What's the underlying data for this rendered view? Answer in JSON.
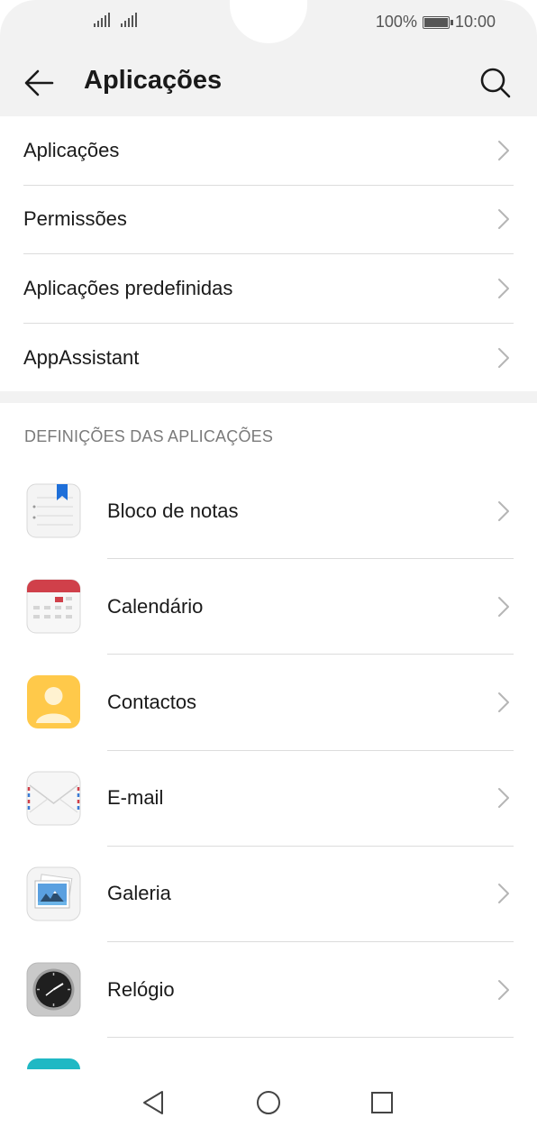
{
  "status_bar": {
    "battery_percent": "100%",
    "time": "10:00"
  },
  "title_bar": {
    "title": "Aplicações"
  },
  "menu": {
    "items": [
      {
        "label": "Aplicações"
      },
      {
        "label": "Permissões"
      },
      {
        "label": "Aplicações predefinidas"
      },
      {
        "label": "AppAssistant"
      }
    ]
  },
  "section": {
    "header": "DEFINIÇÕES DAS APLICAÇÕES"
  },
  "apps": [
    {
      "label": "Bloco de notas",
      "icon": "notepad-icon"
    },
    {
      "label": "Calendário",
      "icon": "calendar-icon"
    },
    {
      "label": "Contactos",
      "icon": "contacts-icon"
    },
    {
      "label": "E-mail",
      "icon": "email-icon"
    },
    {
      "label": "Galeria",
      "icon": "gallery-icon"
    },
    {
      "label": "Relógio",
      "icon": "clock-icon"
    }
  ],
  "colors": {
    "background": "#ffffff",
    "header_background": "#f2f2f2",
    "divider": "#dcdcdc",
    "section_text": "#7a7a7a",
    "notepad_bookmark": "#1e6fd9",
    "calendar_red": "#d0404a",
    "contacts_yellow": "#ffc94a",
    "teal_partial_icon": "#1fb8c4"
  }
}
